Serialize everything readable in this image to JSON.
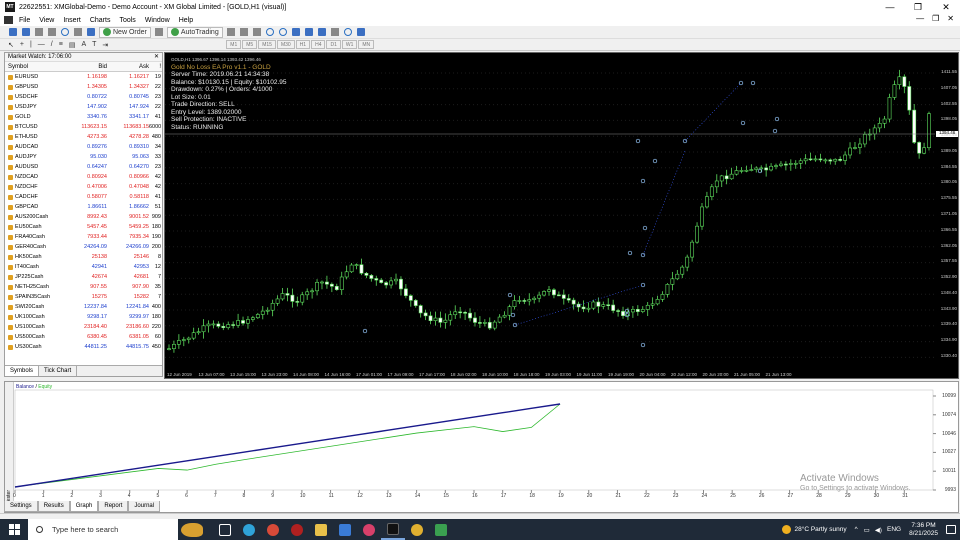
{
  "window": {
    "title": "22622551: XMGlobal-Demo - Demo Account - XM Global Limited - [GOLD,H1 (visual)]",
    "controls": [
      "—",
      "❐",
      "✕"
    ]
  },
  "menu": [
    "File",
    "View",
    "Insert",
    "Charts",
    "Tools",
    "Window",
    "Help"
  ],
  "toolbar": {
    "new_order": "New Order",
    "autotrading": "AutoTrading",
    "timeframes": [
      "M1",
      "M5",
      "M15",
      "M30",
      "H1",
      "H4",
      "D1",
      "W1",
      "MN"
    ]
  },
  "market_watch": {
    "title": "Market Watch: 17:06:00",
    "columns": [
      "Symbol",
      "Bid",
      "Ask",
      "!"
    ],
    "rows": [
      {
        "symbol": "EURUSD",
        "bid": "1.16198",
        "ask": "1.16217",
        "spread": "19",
        "dir": "down"
      },
      {
        "symbol": "GBPUSD",
        "bid": "1.34305",
        "ask": "1.34327",
        "spread": "22",
        "dir": "down"
      },
      {
        "symbol": "USDCHF",
        "bid": "0.80722",
        "ask": "0.80745",
        "spread": "23",
        "dir": "up"
      },
      {
        "symbol": "USDJPY",
        "bid": "147.902",
        "ask": "147.924",
        "spread": "22",
        "dir": "up"
      },
      {
        "symbol": "GOLD",
        "bid": "3340.76",
        "ask": "3341.17",
        "spread": "41",
        "dir": "up"
      },
      {
        "symbol": "BTCUSD",
        "bid": "113623.15",
        "ask": "113683.15",
        "spread": "6000",
        "dir": "down"
      },
      {
        "symbol": "ETHUSD",
        "bid": "4273.36",
        "ask": "4278.28",
        "spread": "480",
        "dir": "down"
      },
      {
        "symbol": "AUDCAD",
        "bid": "0.89276",
        "ask": "0.89310",
        "spread": "34",
        "dir": "up"
      },
      {
        "symbol": "AUDJPY",
        "bid": "95.030",
        "ask": "95.063",
        "spread": "33",
        "dir": "up"
      },
      {
        "symbol": "AUDUSD",
        "bid": "0.64247",
        "ask": "0.64270",
        "spread": "23",
        "dir": "up"
      },
      {
        "symbol": "NZDCAD",
        "bid": "0.80924",
        "ask": "0.80966",
        "spread": "42",
        "dir": "down"
      },
      {
        "symbol": "NZDCHF",
        "bid": "0.47006",
        "ask": "0.47048",
        "spread": "42",
        "dir": "down"
      },
      {
        "symbol": "CADCHF",
        "bid": "0.58077",
        "ask": "0.58118",
        "spread": "41",
        "dir": "down"
      },
      {
        "symbol": "GBPCAD",
        "bid": "1.86611",
        "ask": "1.86662",
        "spread": "51",
        "dir": "up"
      },
      {
        "symbol": "AUS200Cash",
        "bid": "8992.43",
        "ask": "9001.52",
        "spread": "909",
        "dir": "down"
      },
      {
        "symbol": "EU50Cash",
        "bid": "5457.45",
        "ask": "5459.25",
        "spread": "180",
        "dir": "down"
      },
      {
        "symbol": "FRA40Cash",
        "bid": "7933.44",
        "ask": "7935.34",
        "spread": "190",
        "dir": "down"
      },
      {
        "symbol": "GER40Cash",
        "bid": "24264.09",
        "ask": "24266.09",
        "spread": "200",
        "dir": "up"
      },
      {
        "symbol": "HK50Cash",
        "bid": "25138",
        "ask": "25146",
        "spread": "8",
        "dir": "down"
      },
      {
        "symbol": "IT40Cash",
        "bid": "42941",
        "ask": "42953",
        "spread": "12",
        "dir": "up"
      },
      {
        "symbol": "JP225Cash",
        "bid": "42674",
        "ask": "42681",
        "spread": "7",
        "dir": "down"
      },
      {
        "symbol": "NETH25Cash",
        "bid": "907.55",
        "ask": "907.90",
        "spread": "35",
        "dir": "down"
      },
      {
        "symbol": "SPAIN35Cash",
        "bid": "15275",
        "ask": "15282",
        "spread": "7",
        "dir": "down"
      },
      {
        "symbol": "SWI20Cash",
        "bid": "12237.84",
        "ask": "12241.84",
        "spread": "400",
        "dir": "up"
      },
      {
        "symbol": "UK100Cash",
        "bid": "9298.17",
        "ask": "9299.97",
        "spread": "180",
        "dir": "up"
      },
      {
        "symbol": "US100Cash",
        "bid": "23184.40",
        "ask": "23186.60",
        "spread": "220",
        "dir": "down"
      },
      {
        "symbol": "US500Cash",
        "bid": "6380.45",
        "ask": "6381.05",
        "spread": "60",
        "dir": "down"
      },
      {
        "symbol": "US30Cash",
        "bid": "44811.25",
        "ask": "44815.75",
        "spread": "450",
        "dir": "up"
      }
    ],
    "tabs": [
      "Symbols",
      "Tick Chart"
    ]
  },
  "chart": {
    "symbol_line": "GOLD,H1  1396.67 1396.14 1393.42 1396.46",
    "ea_name": "Gold No Loss EA Pro v1.1 - GOLD",
    "info_lines": [
      "Server Time: 2019.06.21 14:34:38",
      "Balance: $10130.15 | Equity: $10102.95",
      "Drawdown: 0.27% | Orders: 4/1000",
      "Lot Size: 0.01",
      "Trade Direction: SELL",
      "Entry Level: 1389.02000",
      "Sell Protection: INACTIVE",
      "Status: RUNNING"
    ],
    "price_labels": [
      "1411.55",
      "1407.05",
      "1402.55",
      "1398.05",
      "1394.46",
      "1389.05",
      "1384.55",
      "1380.05",
      "1375.55",
      "1371.05",
      "1366.55",
      "1362.05",
      "1357.55",
      "1352.90",
      "1348.40",
      "1343.90",
      "1339.40",
      "1334.90",
      "1330.40"
    ],
    "current_price": "1394.46",
    "time_labels": [
      "12 Jun 2019",
      "13 Jun 07:00",
      "13 Jun 15:00",
      "13 Jun 23:00",
      "14 Jun 08:00",
      "14 Jun 16:00",
      "17 Jun 01:00",
      "17 Jun 09:00",
      "17 Jun 17:00",
      "18 Jun 02:00",
      "18 Jun 10:00",
      "18 Jun 18:00",
      "19 Jun 03:00",
      "19 Jun 11:00",
      "19 Jun 19:00",
      "20 Jun 04:00",
      "20 Jun 12:00",
      "20 Jun 20:00",
      "21 Jun 05:00",
      "21 Jun 13:00"
    ]
  },
  "tester": {
    "side_label": "Tester",
    "legend_balance": "Balance",
    "legend_equity": "Equity",
    "y_labels": [
      "10099",
      "10074",
      "10046",
      "10027",
      "10011",
      "9993"
    ],
    "x_labels": [
      "0",
      "1",
      "2",
      "3",
      "4",
      "5",
      "6",
      "7",
      "8",
      "9",
      "10",
      "11",
      "12",
      "13",
      "14",
      "15",
      "16",
      "17",
      "18",
      "19",
      "20",
      "21",
      "22",
      "23",
      "24",
      "25",
      "26",
      "27",
      "28",
      "29",
      "30",
      "31"
    ],
    "balance_color": "#1a1a8c",
    "equity_color": "#2db82d",
    "tabs": [
      "Settings",
      "Results",
      "Graph",
      "Report",
      "Journal"
    ],
    "active_tab": "Graph"
  },
  "watermark": {
    "title": "Activate Windows",
    "subtitle": "Go to Settings to activate Windows."
  },
  "taskbar": {
    "search_placeholder": "Type here to search",
    "weather": "28°C  Partly sunny",
    "time": "7:36 PM",
    "date": "8/21/2025"
  }
}
